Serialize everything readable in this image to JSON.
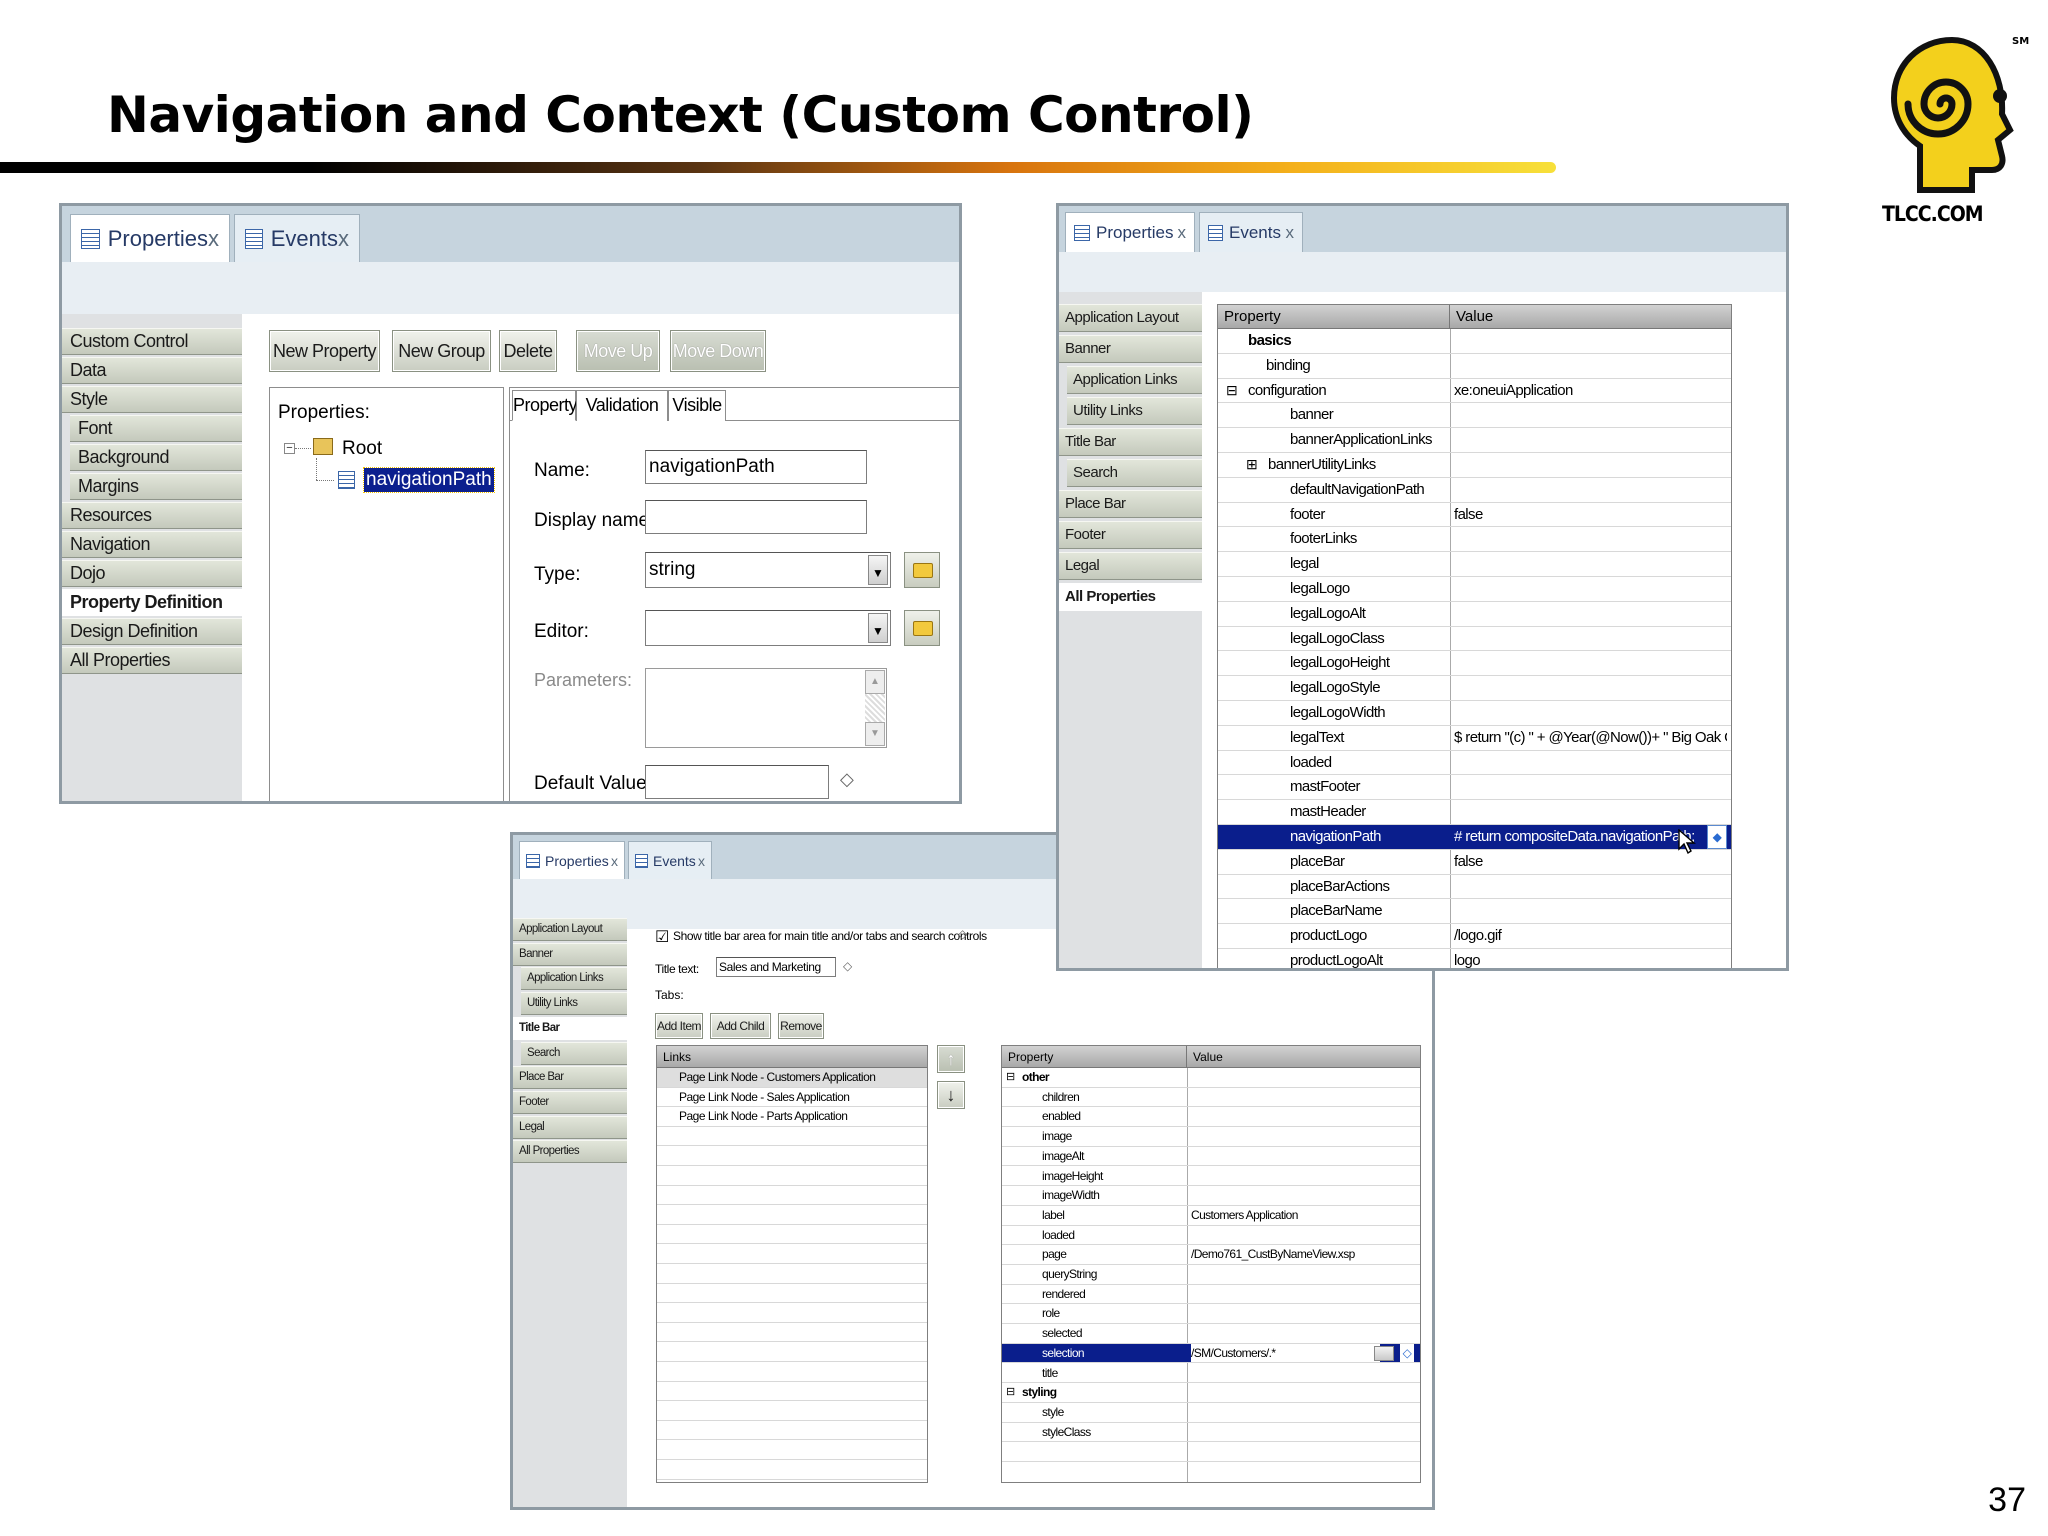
{
  "slide": {
    "title": "Navigation and Context (Custom Control)",
    "page_number": "37",
    "logo_text": "TLCC.COM",
    "logo_mark": "SM"
  },
  "p1": {
    "tabs": [
      {
        "label": "Properties",
        "close": "x"
      },
      {
        "label": "Events",
        "close": "x"
      }
    ],
    "side": [
      "Custom Control",
      "Data",
      "Style",
      "Font",
      "Background",
      "Margins",
      "Resources",
      "Navigation",
      "Dojo",
      "Property Definition",
      "Design Definition",
      "All Properties"
    ],
    "buttons": [
      "New Property",
      "New Group",
      "Delete",
      "Move Up",
      "Move Down"
    ],
    "properties_label": "Properties:",
    "tree": {
      "root": "Root",
      "child": "navigationPath"
    },
    "subtabs": [
      "Property",
      "Validation",
      "Visible"
    ],
    "form": {
      "name_label": "Name:",
      "name_value": "navigationPath",
      "display_label": "Display name:",
      "display_value": "",
      "type_label": "Type:",
      "type_value": "string",
      "editor_label": "Editor:",
      "editor_value": "",
      "params_label": "Parameters:",
      "default_label": "Default Value:",
      "default_value": "",
      "diamond": "◇",
      "dd": "▼",
      "up": "▲",
      "down": "▼"
    }
  },
  "p2": {
    "tabs": [
      {
        "label": "Properties",
        "close": "x"
      },
      {
        "label": "Events",
        "close": "x"
      }
    ],
    "side": [
      "Application Layout",
      "Banner",
      "Application Links",
      "Utility Links",
      "Title Bar",
      "Search",
      "Place Bar",
      "Footer",
      "Legal",
      "All Properties"
    ],
    "headers": [
      "Property",
      "Value"
    ],
    "rows": [
      {
        "exp": "⊟",
        "name": "basics",
        "value": ""
      },
      {
        "exp": "",
        "name": "binding",
        "value": ""
      },
      {
        "exp": "⊟",
        "name": "configuration",
        "value": "xe:oneuiApplication"
      },
      {
        "exp": "",
        "name": "banner",
        "value": ""
      },
      {
        "exp": "",
        "name": "bannerApplicationLinks",
        "value": ""
      },
      {
        "exp": "⊞",
        "name": "bannerUtilityLinks",
        "value": ""
      },
      {
        "exp": "",
        "name": "defaultNavigationPath",
        "value": ""
      },
      {
        "exp": "",
        "name": "footer",
        "value": "false"
      },
      {
        "exp": "",
        "name": "footerLinks",
        "value": ""
      },
      {
        "exp": "",
        "name": "legal",
        "value": ""
      },
      {
        "exp": "",
        "name": "legalLogo",
        "value": ""
      },
      {
        "exp": "",
        "name": "legalLogoAlt",
        "value": ""
      },
      {
        "exp": "",
        "name": "legalLogoClass",
        "value": ""
      },
      {
        "exp": "",
        "name": "legalLogoHeight",
        "value": ""
      },
      {
        "exp": "",
        "name": "legalLogoStyle",
        "value": ""
      },
      {
        "exp": "",
        "name": "legalLogoWidth",
        "value": ""
      },
      {
        "exp": "",
        "name": "legalText",
        "value": "$ return \"(c) \" + @Year(@Now())+ \" Big Oak Golf\""
      },
      {
        "exp": "",
        "name": "loaded",
        "value": ""
      },
      {
        "exp": "",
        "name": "mastFooter",
        "value": ""
      },
      {
        "exp": "",
        "name": "mastHeader",
        "value": ""
      },
      {
        "exp": "",
        "name": "navigationPath",
        "value": "# return compositeData.navigationPath;"
      },
      {
        "exp": "",
        "name": "placeBar",
        "value": "false"
      },
      {
        "exp": "",
        "name": "placeBarActions",
        "value": ""
      },
      {
        "exp": "",
        "name": "placeBarName",
        "value": ""
      },
      {
        "exp": "",
        "name": "productLogo",
        "value": "/logo.gif"
      },
      {
        "exp": "",
        "name": "productLogoAlt",
        "value": "logo"
      }
    ],
    "diamond": "◆"
  },
  "p3": {
    "tabs": [
      {
        "label": "Properties",
        "close": "x"
      },
      {
        "label": "Events",
        "close": "x"
      }
    ],
    "side": [
      "Application Layout",
      "Banner",
      "Application Links",
      "Utility Links",
      "Title Bar",
      "Search",
      "Place Bar",
      "Footer",
      "Legal",
      "All Properties"
    ],
    "checkbox_label": "Show title bar area for main title and/or tabs and search controls",
    "checkbox_mark": "☑",
    "title_text_label": "Title text:",
    "title_text_value": "Sales and Marketing",
    "tabs_label": "Tabs:",
    "diamond": "◇",
    "buttons": [
      "Add Item",
      "Add Child",
      "Remove"
    ],
    "links_header": "Links",
    "links": [
      "Page Link Node - Customers Application",
      "Page Link Node - Sales Application",
      "Page Link Node - Parts Application"
    ],
    "arrow_up": "↑",
    "arrow_down": "↓",
    "headers": [
      "Property",
      "Value"
    ],
    "rows": [
      {
        "exp": "⊟",
        "name": "other",
        "value": ""
      },
      {
        "exp": "",
        "name": "children",
        "value": ""
      },
      {
        "exp": "",
        "name": "enabled",
        "value": ""
      },
      {
        "exp": "",
        "name": "image",
        "value": ""
      },
      {
        "exp": "",
        "name": "imageAlt",
        "value": ""
      },
      {
        "exp": "",
        "name": "imageHeight",
        "value": ""
      },
      {
        "exp": "",
        "name": "imageWidth",
        "value": ""
      },
      {
        "exp": "",
        "name": "label",
        "value": "Customers Application"
      },
      {
        "exp": "",
        "name": "loaded",
        "value": ""
      },
      {
        "exp": "",
        "name": "page",
        "value": "/Demo761_CustByNameView.xsp"
      },
      {
        "exp": "",
        "name": "queryString",
        "value": ""
      },
      {
        "exp": "",
        "name": "rendered",
        "value": ""
      },
      {
        "exp": "",
        "name": "role",
        "value": ""
      },
      {
        "exp": "",
        "name": "selected",
        "value": ""
      },
      {
        "exp": "",
        "name": "selection",
        "value": "/SM/Customers/.*"
      },
      {
        "exp": "",
        "name": "title",
        "value": ""
      },
      {
        "exp": "⊟",
        "name": "styling",
        "value": ""
      },
      {
        "exp": "",
        "name": "style",
        "value": ""
      },
      {
        "exp": "",
        "name": "styleClass",
        "value": ""
      }
    ],
    "cell_diamond": "◇"
  }
}
